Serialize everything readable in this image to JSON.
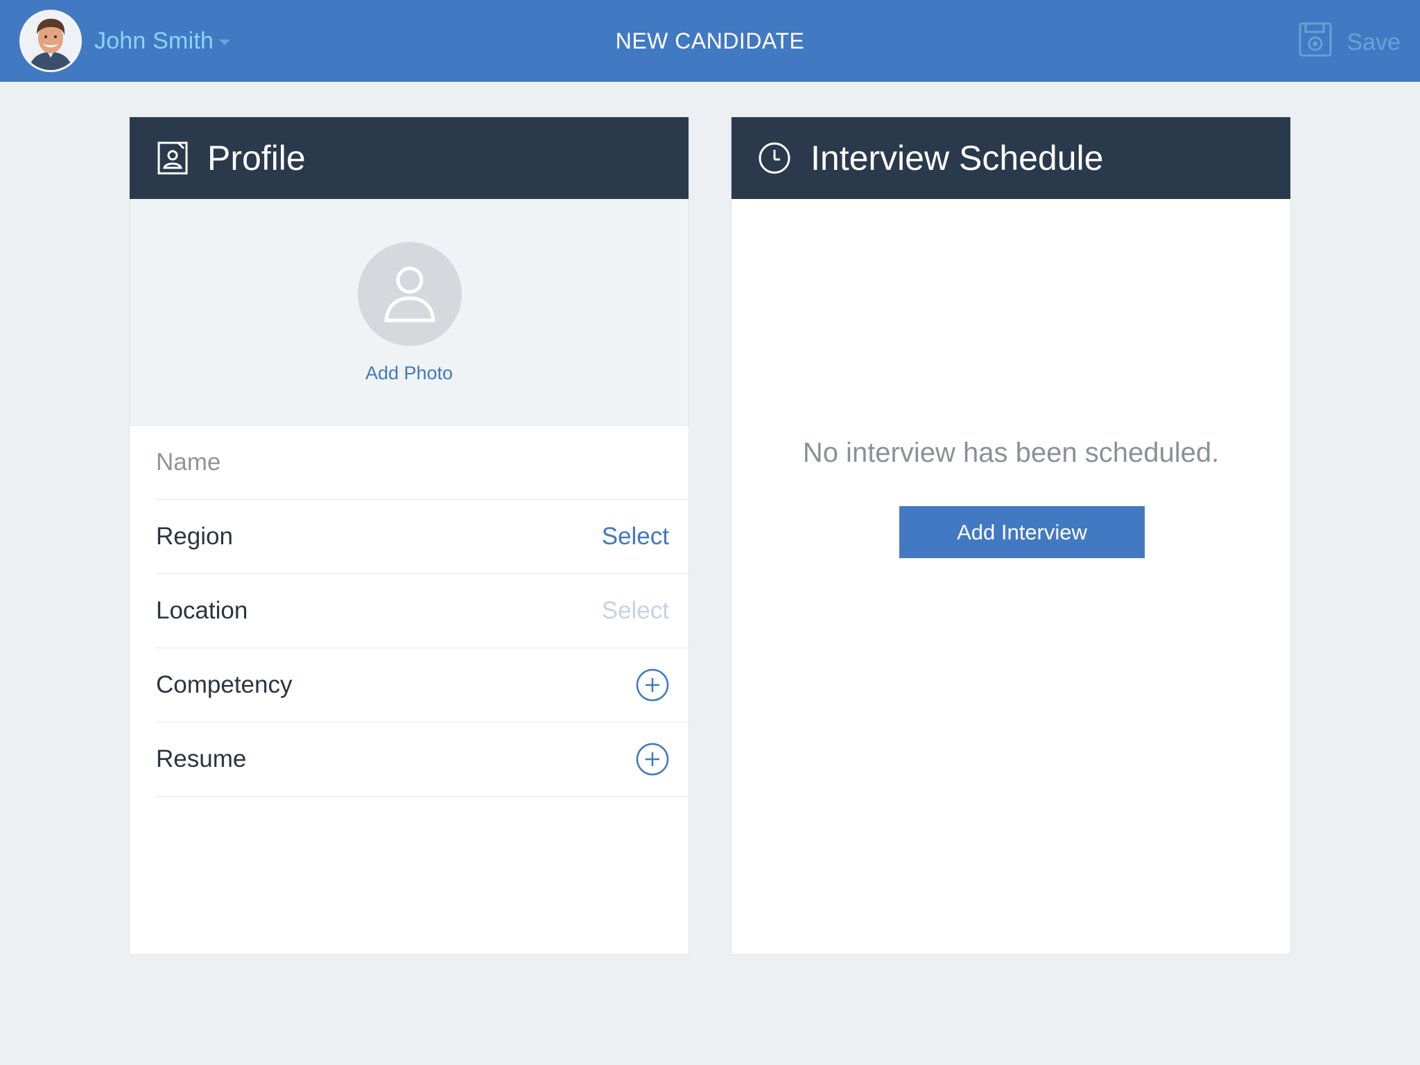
{
  "topbar": {
    "user_name": "John Smith",
    "page_title": "NEW CANDIDATE",
    "save_label": "Save"
  },
  "profile": {
    "header_title": "Profile",
    "add_photo_label": "Add Photo",
    "fields": {
      "name_placeholder": "Name",
      "region_label": "Region",
      "region_value": "Select",
      "location_label": "Location",
      "location_value": "Select",
      "competency_label": "Competency",
      "resume_label": "Resume"
    }
  },
  "schedule": {
    "header_title": "Interview Schedule",
    "empty_message": "No interview has been scheduled.",
    "add_interview_label": "Add Interview"
  },
  "colors": {
    "topbar": "#4279c3",
    "card_header": "#2a394b",
    "accent": "#3f78c1",
    "background": "#edf0f3"
  },
  "icons": {
    "user_avatar": "avatar-photo",
    "save": "floppy-disk-icon",
    "profile_header": "contact-card-icon",
    "schedule_header": "clock-icon",
    "photo_placeholder": "person-silhouette-icon",
    "add": "plus-circle-icon"
  }
}
